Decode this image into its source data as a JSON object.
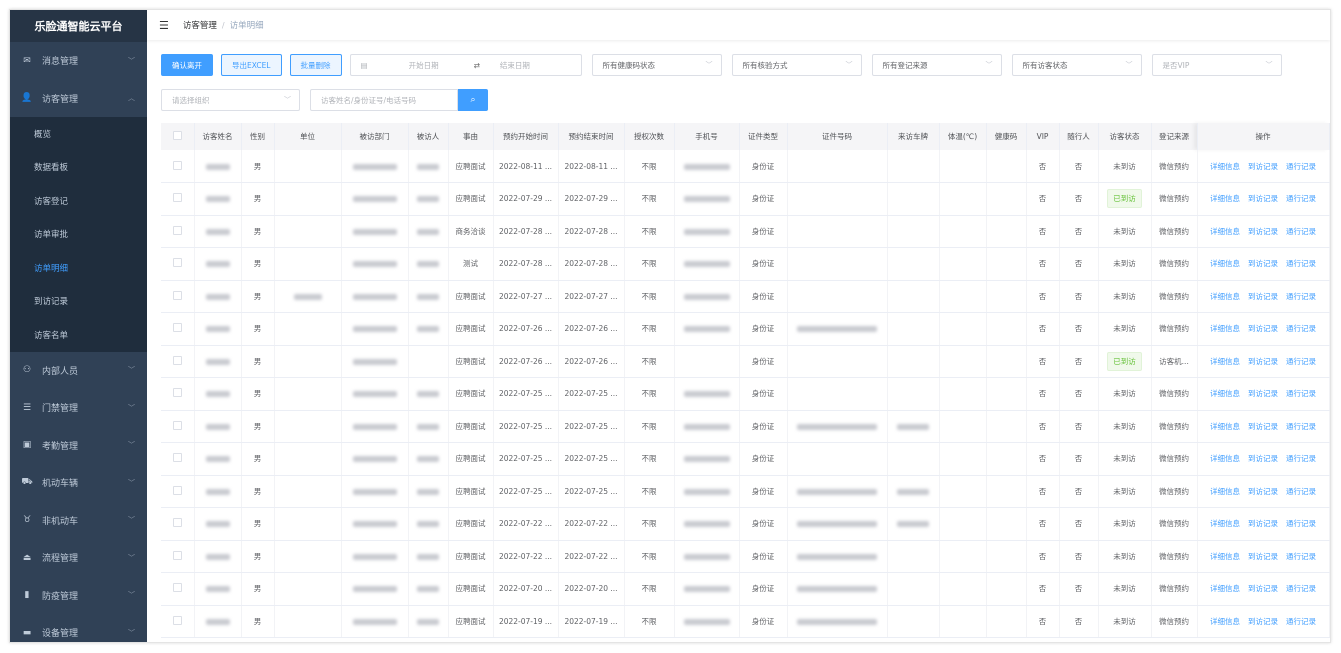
{
  "app": {
    "title": "乐脸通智能云平台"
  },
  "sidebar": {
    "items": [
      {
        "label": "消息管理",
        "icon": "mail-icon",
        "glyph": "✉",
        "expanded": false
      },
      {
        "label": "访客管理",
        "icon": "user-icon",
        "glyph": "👤",
        "expanded": true,
        "children": [
          "概览",
          "数据看板",
          "访客登记",
          "访单审批",
          "访单明细",
          "到访记录",
          "访客名单"
        ],
        "active_child": "访单明细"
      },
      {
        "label": "内部人员",
        "icon": "staff-icon",
        "glyph": "⚇"
      },
      {
        "label": "门禁管理",
        "icon": "list-icon",
        "glyph": "☰"
      },
      {
        "label": "考勤管理",
        "icon": "calendar-icon",
        "glyph": "▣"
      },
      {
        "label": "机动车辆",
        "icon": "car-icon",
        "glyph": "⛟"
      },
      {
        "label": "非机动车",
        "icon": "bike-icon",
        "glyph": "♉"
      },
      {
        "label": "流程管理",
        "icon": "stamp-icon",
        "glyph": "⏏"
      },
      {
        "label": "防疫管理",
        "icon": "bottle-icon",
        "glyph": "▮"
      },
      {
        "label": "设备管理",
        "icon": "monitor-icon",
        "glyph": "▬"
      }
    ]
  },
  "breadcrumb": [
    "访客管理",
    "访单明细"
  ],
  "toolbar": {
    "confirm_leave": "确认离开",
    "export": "导出EXCEL",
    "batch_delete": "批量删除",
    "start_date": "开始日期",
    "end_date": "结束日期",
    "filters": [
      "所有健康码状态",
      "所有核验方式",
      "所有登记来源",
      "所有访客状态",
      "是否VIP"
    ],
    "org_placeholder": "请选择组织",
    "search_placeholder": "访客姓名/身份证号/电话号码"
  },
  "colors": {
    "accent": "#409eff",
    "sidebar": "#304156",
    "arrived": "#67c23a"
  },
  "table": {
    "columns": [
      "访客姓名",
      "性别",
      "单位",
      "被访部门",
      "被访人",
      "事由",
      "预约开始时间",
      "预约结束时间",
      "授权次数",
      "手机号",
      "证件类型",
      "证件号码",
      "来访车牌",
      "体温(℃)",
      "健康码",
      "VIP",
      "随行人",
      "访客状态",
      "登记来源",
      "操作"
    ],
    "actions": [
      "详细信息",
      "到访记录",
      "通行记录"
    ],
    "rows": [
      {
        "gender": "男",
        "reason": "应聘面试",
        "start": "2022-08-11 ...",
        "end": "2022-08-11 ...",
        "count": "不限",
        "id_type": "身份证",
        "vip": "否",
        "companion": "否",
        "status": "未到访",
        "source": "微信预约",
        "unit": false,
        "host": true,
        "phone": true,
        "idno": false,
        "plate": false
      },
      {
        "gender": "男",
        "reason": "应聘面试",
        "start": "2022-07-29 ...",
        "end": "2022-07-29 ...",
        "count": "不限",
        "id_type": "身份证",
        "vip": "否",
        "companion": "否",
        "status": "已到访",
        "source": "微信预约",
        "unit": false,
        "host": true,
        "phone": true,
        "idno": false,
        "plate": false
      },
      {
        "gender": "男",
        "reason": "商务洽谈",
        "start": "2022-07-28 ...",
        "end": "2022-07-28 ...",
        "count": "不限",
        "id_type": "身份证",
        "vip": "否",
        "companion": "否",
        "status": "未到访",
        "source": "微信预约",
        "unit": false,
        "host": true,
        "phone": true,
        "idno": false,
        "plate": false
      },
      {
        "gender": "男",
        "reason": "测试",
        "start": "2022-07-28 ...",
        "end": "2022-07-28 ...",
        "count": "不限",
        "id_type": "身份证",
        "vip": "否",
        "companion": "否",
        "status": "未到访",
        "source": "微信预约",
        "unit": false,
        "host": true,
        "phone": true,
        "idno": false,
        "plate": false
      },
      {
        "gender": "男",
        "reason": "应聘面试",
        "start": "2022-07-27 ...",
        "end": "2022-07-27 ...",
        "count": "不限",
        "id_type": "身份证",
        "vip": "否",
        "companion": "否",
        "status": "未到访",
        "source": "微信预约",
        "unit": true,
        "host": true,
        "phone": true,
        "idno": false,
        "plate": false
      },
      {
        "gender": "男",
        "reason": "应聘面试",
        "start": "2022-07-26 ...",
        "end": "2022-07-26 ...",
        "count": "不限",
        "id_type": "身份证",
        "vip": "否",
        "companion": "否",
        "status": "未到访",
        "source": "微信预约",
        "unit": false,
        "host": true,
        "phone": true,
        "idno": true,
        "plate": false
      },
      {
        "gender": "男",
        "reason": "应聘面试",
        "start": "2022-07-26 ...",
        "end": "2022-07-26 ...",
        "count": "不限",
        "id_type": "身份证",
        "vip": "否",
        "companion": "否",
        "status": "已到访",
        "source": "访客机...",
        "unit": false,
        "host": false,
        "phone": false,
        "idno": false,
        "plate": false
      },
      {
        "gender": "男",
        "reason": "应聘面试",
        "start": "2022-07-25 ...",
        "end": "2022-07-25 ...",
        "count": "不限",
        "id_type": "身份证",
        "vip": "否",
        "companion": "否",
        "status": "未到访",
        "source": "微信预约",
        "unit": false,
        "host": true,
        "phone": true,
        "idno": false,
        "plate": false
      },
      {
        "gender": "男",
        "reason": "应聘面试",
        "start": "2022-07-25 ...",
        "end": "2022-07-25 ...",
        "count": "不限",
        "id_type": "身份证",
        "vip": "否",
        "companion": "否",
        "status": "未到访",
        "source": "微信预约",
        "unit": false,
        "host": true,
        "phone": true,
        "idno": true,
        "plate": true
      },
      {
        "gender": "男",
        "reason": "应聘面试",
        "start": "2022-07-25 ...",
        "end": "2022-07-25 ...",
        "count": "不限",
        "id_type": "身份证",
        "vip": "否",
        "companion": "否",
        "status": "未到访",
        "source": "微信预约",
        "unit": false,
        "host": true,
        "phone": true,
        "idno": false,
        "plate": false
      },
      {
        "gender": "男",
        "reason": "应聘面试",
        "start": "2022-07-25 ...",
        "end": "2022-07-25 ...",
        "count": "不限",
        "id_type": "身份证",
        "vip": "否",
        "companion": "否",
        "status": "未到访",
        "source": "微信预约",
        "unit": false,
        "host": true,
        "phone": true,
        "idno": true,
        "plate": true
      },
      {
        "gender": "男",
        "reason": "应聘面试",
        "start": "2022-07-22 ...",
        "end": "2022-07-22 ...",
        "count": "不限",
        "id_type": "身份证",
        "vip": "否",
        "companion": "否",
        "status": "未到访",
        "source": "微信预约",
        "unit": false,
        "host": true,
        "phone": true,
        "idno": true,
        "plate": true
      },
      {
        "gender": "男",
        "reason": "应聘面试",
        "start": "2022-07-22 ...",
        "end": "2022-07-22 ...",
        "count": "不限",
        "id_type": "身份证",
        "vip": "否",
        "companion": "否",
        "status": "未到访",
        "source": "微信预约",
        "unit": false,
        "host": true,
        "phone": true,
        "idno": true,
        "plate": false
      },
      {
        "gender": "男",
        "reason": "应聘面试",
        "start": "2022-07-20 ...",
        "end": "2022-07-20 ...",
        "count": "不限",
        "id_type": "身份证",
        "vip": "否",
        "companion": "否",
        "status": "未到访",
        "source": "微信预约",
        "unit": false,
        "host": true,
        "phone": true,
        "idno": true,
        "plate": false
      },
      {
        "gender": "男",
        "reason": "应聘面试",
        "start": "2022-07-19 ...",
        "end": "2022-07-19 ...",
        "count": "不限",
        "id_type": "身份证",
        "vip": "否",
        "companion": "否",
        "status": "未到访",
        "source": "微信预约",
        "unit": false,
        "host": true,
        "phone": true,
        "idno": true,
        "plate": false
      }
    ]
  }
}
